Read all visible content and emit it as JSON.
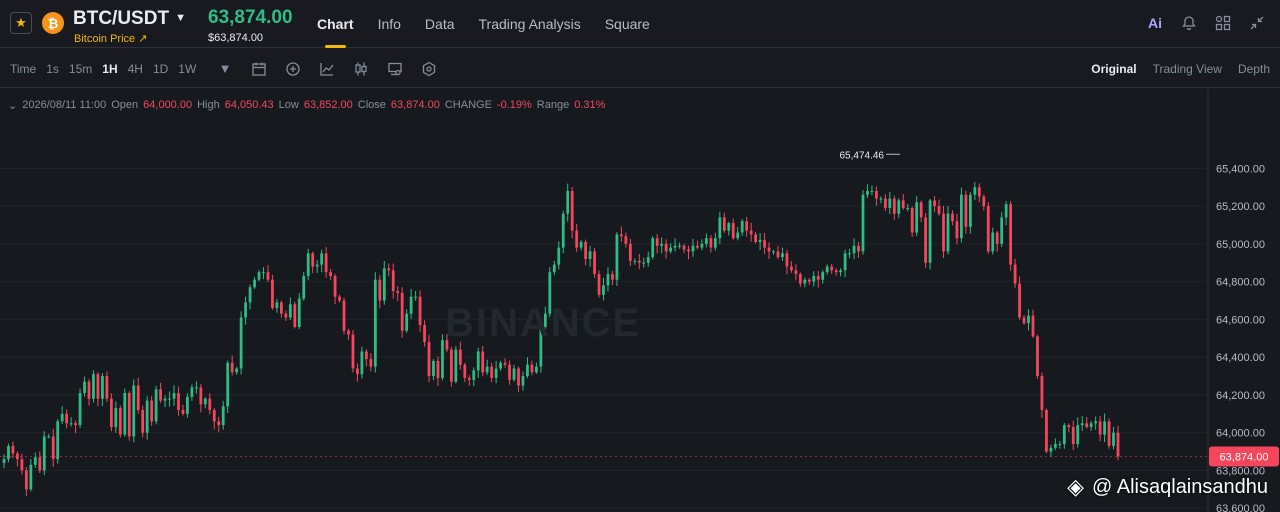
{
  "header": {
    "pair": "BTC/USDT",
    "subtitle": "Bitcoin Price",
    "subtitle_arrow": "↗",
    "price": "63,874.00",
    "price_usd": "$63,874.00",
    "coin_symbol": "₿",
    "tabs": [
      {
        "label": "Chart",
        "active": true
      },
      {
        "label": "Info",
        "active": false
      },
      {
        "label": "Data",
        "active": false
      },
      {
        "label": "Trading Analysis",
        "active": false
      },
      {
        "label": "Square",
        "active": false
      }
    ],
    "ai_label": "Ai"
  },
  "toolbar": {
    "intervals": [
      {
        "label": "Time",
        "active": false
      },
      {
        "label": "1s",
        "active": false
      },
      {
        "label": "15m",
        "active": false
      },
      {
        "label": "1H",
        "active": true
      },
      {
        "label": "4H",
        "active": false
      },
      {
        "label": "1D",
        "active": false
      },
      {
        "label": "1W",
        "active": false
      }
    ],
    "views": [
      {
        "label": "Original",
        "active": true
      },
      {
        "label": "Trading View",
        "active": false
      },
      {
        "label": "Depth",
        "active": false
      }
    ]
  },
  "ohlc": {
    "date": "2026/08/11 11:00",
    "open_label": "Open",
    "open": "64,000.00",
    "high_label": "High",
    "high": "64,050.43",
    "low_label": "Low",
    "low": "63,852.00",
    "close_label": "Close",
    "close": "63,874.00",
    "change_label": "CHANGE",
    "change": "-0.19%",
    "range_label": "Range",
    "range": "0.31%"
  },
  "watermark": "BINANCE",
  "credit": "@ Alisaqlainsandhu",
  "colors": {
    "up": "#2ebd85",
    "down": "#f6465d",
    "accent": "#f0b90b"
  },
  "chart_data": {
    "type": "candlestick",
    "y_ticks": [
      "65,400.00",
      "65,200.00",
      "65,000.00",
      "64,800.00",
      "64,600.00",
      "64,400.00",
      "64,200.00",
      "64,000.00",
      "63,800.00",
      "63,600.00"
    ],
    "ylim": [
      63580,
      65820
    ],
    "high_marker": {
      "value": 65474.46,
      "label": "65,474.46"
    },
    "last_price": {
      "value": 63874,
      "label": "63,874.00"
    },
    "closes": [
      63860,
      63930,
      63890,
      63860,
      63800,
      63700,
      63830,
      63870,
      63800,
      63980,
      63980,
      63860,
      64060,
      64100,
      64050,
      64050,
      64040,
      64210,
      64270,
      64180,
      64310,
      64180,
      64300,
      64180,
      64030,
      64130,
      63990,
      64210,
      63980,
      64250,
      64120,
      64000,
      64170,
      64060,
      64230,
      64170,
      64180,
      64180,
      64210,
      64120,
      64100,
      64190,
      64240,
      64240,
      64150,
      64180,
      64120,
      64060,
      64040,
      64140,
      64370,
      64320,
      64340,
      64610,
      64690,
      64770,
      64810,
      64850,
      64850,
      64810,
      64660,
      64690,
      64630,
      64610,
      64680,
      64560,
      64710,
      64830,
      64950,
      64880,
      64890,
      64950,
      64850,
      64830,
      64720,
      64700,
      64540,
      64520,
      64340,
      64310,
      64430,
      64390,
      64350,
      64810,
      64700,
      64870,
      64860,
      64750,
      64740,
      64540,
      64630,
      64720,
      64720,
      64570,
      64480,
      64300,
      64380,
      64290,
      64490,
      64440,
      64270,
      64440,
      64360,
      64290,
      64280,
      64330,
      64430,
      64320,
      64350,
      64290,
      64340,
      64370,
      64360,
      64280,
      64340,
      64250,
      64300,
      64360,
      64320,
      64350,
      64560,
      64630,
      64850,
      64890,
      64980,
      65160,
      65280,
      65070,
      64980,
      65010,
      64920,
      64960,
      64840,
      64730,
      64780,
      64840,
      64810,
      65050,
      65040,
      65000,
      64910,
      64910,
      64900,
      64900,
      64930,
      65030,
      64990,
      65000,
      64960,
      64980,
      64990,
      64990,
      64970,
      64960,
      64990,
      64980,
      65000,
      65030,
      64980,
      65030,
      65140,
      65070,
      65110,
      65030,
      65060,
      65120,
      65070,
      65050,
      65010,
      65020,
      64980,
      64960,
      64960,
      64930,
      64950,
      64880,
      64860,
      64840,
      64790,
      64810,
      64800,
      64830,
      64810,
      64850,
      64880,
      64860,
      64850,
      64860,
      64950,
      64950,
      64990,
      64960,
      65260,
      65280,
      65280,
      65240,
      65240,
      65190,
      65240,
      65160,
      65230,
      65190,
      65190,
      65060,
      65220,
      65140,
      64900,
      65230,
      65200,
      65160,
      64960,
      65160,
      65120,
      65030,
      65260,
      65090,
      65260,
      65300,
      65250,
      65200,
      64960,
      65060,
      65000,
      65140,
      65210,
      64890,
      64790,
      64610,
      64580,
      64620,
      64510,
      64300,
      64120,
      63900,
      63920,
      63940,
      63940,
      64040,
      64030,
      63940,
      64040,
      64050,
      64030,
      64050,
      64060,
      63990,
      64060,
      63930,
      64000,
      63874
    ]
  }
}
